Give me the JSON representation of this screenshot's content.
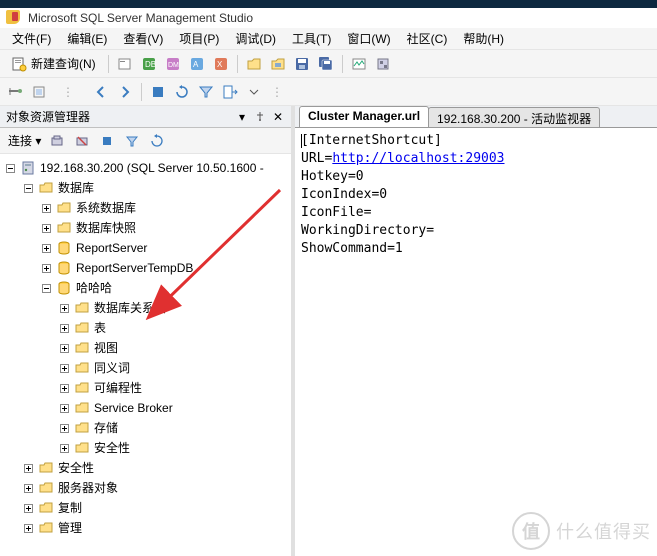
{
  "title": "Microsoft SQL Server Management Studio",
  "menubar": [
    "文件(F)",
    "编辑(E)",
    "查看(V)",
    "项目(P)",
    "调试(D)",
    "工具(T)",
    "窗口(W)",
    "社区(C)",
    "帮助(H)"
  ],
  "toolbar1": {
    "newquery": "新建查询(N)"
  },
  "explorer": {
    "title": "对象资源管理器",
    "connect": "连接 ▾",
    "root": {
      "label": "192.168.30.200 (SQL Server 10.50.1600 -",
      "children": [
        {
          "label": "数据库",
          "expanded": true,
          "children": [
            {
              "label": "系统数据库",
              "expandable": true
            },
            {
              "label": "数据库快照",
              "expandable": true
            },
            {
              "label": "ReportServer",
              "icon": "db",
              "expandable": true
            },
            {
              "label": "ReportServerTempDB",
              "icon": "db",
              "expandable": true
            },
            {
              "label": "哈哈哈",
              "icon": "db",
              "expanded": true,
              "children": [
                {
                  "label": "数据库关系图",
                  "expandable": true
                },
                {
                  "label": "表",
                  "expandable": true
                },
                {
                  "label": "视图",
                  "expandable": true
                },
                {
                  "label": "同义词",
                  "expandable": true
                },
                {
                  "label": "可编程性",
                  "expandable": true
                },
                {
                  "label": "Service Broker",
                  "expandable": true
                },
                {
                  "label": "存储",
                  "expandable": true
                },
                {
                  "label": "安全性",
                  "expandable": true
                }
              ]
            }
          ]
        },
        {
          "label": "安全性",
          "expandable": true
        },
        {
          "label": "服务器对象",
          "expandable": true
        },
        {
          "label": "复制",
          "expandable": true
        },
        {
          "label": "管理",
          "expandable": true
        }
      ]
    }
  },
  "tabs": [
    {
      "label": "Cluster Manager.url",
      "active": true
    },
    {
      "label": "192.168.30.200 - 活动监视器",
      "active": false
    }
  ],
  "editor_lines": [
    "[InternetShortcut]",
    "URL=http://localhost:29003",
    "Hotkey=0",
    "IconIndex=0",
    "IconFile=",
    "WorkingDirectory=",
    "ShowCommand=1"
  ],
  "watermark": {
    "circle": "值",
    "text": "什么值得买"
  }
}
